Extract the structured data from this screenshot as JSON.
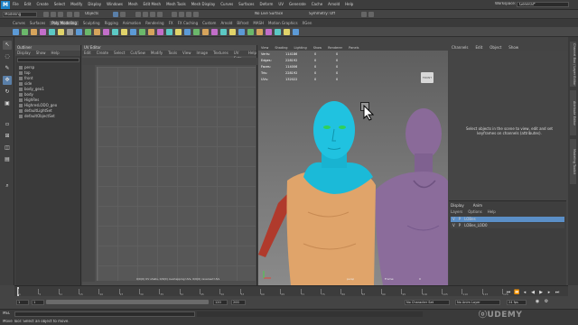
{
  "app": {
    "logo": "M",
    "menus": [
      "File",
      "Edit",
      "Create",
      "Select",
      "Modify",
      "Display",
      "Windows",
      "Mesh",
      "Edit Mesh",
      "Mesh Tools",
      "Mesh Display",
      "Curves",
      "Surfaces",
      "Deform",
      "UV",
      "Generate",
      "Cache",
      "Arnold",
      "Help"
    ],
    "workspace_label": "Workspace:",
    "workspace_value": "General*",
    "statusline": {
      "mode": "Modeling",
      "objects": "Objects",
      "live_surface": "No Live Surface",
      "symmetry": "Symmetry: Off"
    }
  },
  "shelf": {
    "tabs": [
      "Curves",
      "Surfaces",
      "Poly Modeling",
      "Sculpting",
      "Rigging",
      "Animation",
      "Rendering",
      "FX",
      "FX Caching",
      "Custom",
      "Arnold",
      "Bifrost",
      "MASH",
      "Motion Graphics",
      "XGen"
    ],
    "active_tab": "Poly Modeling",
    "icon_colors": [
      "#5c9ad6",
      "#6bb86b",
      "#d6a45c",
      "#c26ec9",
      "#5cc9c4",
      "#e0d36a",
      "#9a9a9a",
      "#5c9ad6",
      "#6bb86b",
      "#d6a45c",
      "#c26ec9",
      "#5cc9c4",
      "#e0d36a",
      "#5c9ad6",
      "#6bb86b",
      "#d6a45c",
      "#c26ec9",
      "#5cc9c4",
      "#e0d36a",
      "#5c9ad6",
      "#6bb86b",
      "#d6a45c",
      "#c26ec9",
      "#5cc9c4",
      "#e0d36a",
      "#5c9ad6",
      "#6bb86b",
      "#d6a45c",
      "#c26ec9",
      "#5cc9c4",
      "#e0d36a",
      "#5c9ad6"
    ]
  },
  "outliner": {
    "title": "Outliner",
    "menu": [
      "Display",
      "Show",
      "Help"
    ],
    "items": [
      "persp",
      "top",
      "front",
      "side",
      "body_geo1",
      "body",
      "HighRes",
      "HighresLODO_geo",
      "defaultLightSet",
      "defaultObjectSet"
    ]
  },
  "uv_editor": {
    "title": "UV Editor",
    "menu": [
      "Edit",
      "Create",
      "Select",
      "Cut/Sew",
      "Modify",
      "Tools",
      "View",
      "Image",
      "Textures",
      "UV Sets",
      "Help"
    ],
    "status": "0/0(0) UV shells, 0/0(0) overlapping UVs, 0/0(0) reversed UVs"
  },
  "viewport": {
    "menu": [
      "View",
      "Shading",
      "Lighting",
      "Show",
      "Renderer",
      "Panels"
    ],
    "hud": [
      {
        "label": "Verts:",
        "v1": "114186",
        "v2": "0",
        "v3": "0"
      },
      {
        "label": "Edges:",
        "v1": "228192",
        "v2": "0",
        "v3": "0"
      },
      {
        "label": "Faces:",
        "v1": "114006",
        "v2": "0",
        "v3": "0"
      },
      {
        "label": "Tris:",
        "v1": "228192",
        "v2": "0",
        "v3": "0"
      },
      {
        "label": "UVs:",
        "v1": "132022",
        "v2": "0",
        "v3": "0"
      }
    ],
    "view_cube": "FRONT",
    "camera": "persp",
    "frame_label": "Frame:",
    "frame_value": "0"
  },
  "channel_box": {
    "tabs": [
      "Channels",
      "Edit",
      "Object",
      "Show"
    ],
    "message": "Select objects in the scene to view, edit and set keyframes on channels (attributes)."
  },
  "layers": {
    "tabs": [
      "Display",
      "Anim"
    ],
    "menu": [
      "Layers",
      "Options",
      "Help"
    ],
    "rows": [
      {
        "v": "V",
        "p": "P",
        "name": "LOBes"
      },
      {
        "v": "V",
        "p": "P",
        "name": "LOBes_LOD0"
      }
    ]
  },
  "side_tabs": [
    "Channel Box / Layer Editor",
    "Attribute Editor",
    "Modeling Toolkit"
  ],
  "timeline": {
    "ticks": [
      "1",
      "5",
      "10",
      "15",
      "20",
      "25",
      "30",
      "35",
      "40",
      "45",
      "50",
      "55",
      "60",
      "65",
      "70",
      "75",
      "80",
      "85",
      "90",
      "95",
      "100",
      "105",
      "110",
      "115",
      "120"
    ],
    "current_frame": "1"
  },
  "range": {
    "start": "1",
    "inner_start": "1",
    "inner_end": "120",
    "end": "200",
    "char_set": "No Character Set",
    "anim_layer": "No Anim Layer",
    "fps": "24 fps"
  },
  "command_line": {
    "lang": "MEL",
    "help": "Move Tool: Select an object to move."
  },
  "watermark": "ⓞUDEMY"
}
